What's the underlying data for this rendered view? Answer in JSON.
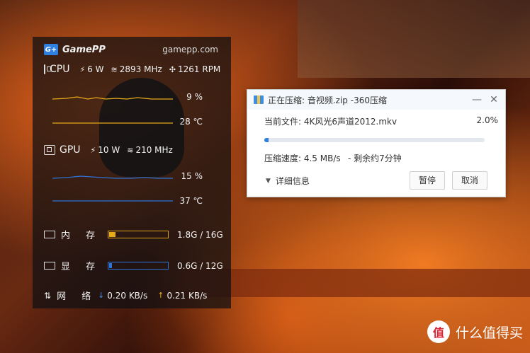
{
  "gamepp": {
    "logo": "G+",
    "brand": "GamePP",
    "site": "gamepp.com",
    "cpu": {
      "label": "CPU",
      "power": "6 W",
      "clock": "2893 MHz",
      "fan": "1261 RPM",
      "usage": "9 %",
      "temp": "28 ℃"
    },
    "gpu": {
      "label": "GPU",
      "power": "10 W",
      "clock": "210 MHz",
      "usage": "15 %",
      "temp": "37 ℃"
    },
    "memory": {
      "label": "内 存",
      "value": "1.8G / 16G",
      "fraction": 0.1125
    },
    "vram": {
      "label": "显 存",
      "value": "0.6G / 12G",
      "fraction": 0.05
    },
    "network": {
      "label": "网 络",
      "down": "0.20 KB/s",
      "up": "0.21 KB/s"
    },
    "colors": {
      "cpu_line": "#e6a918",
      "gpu_line": "#2d74d8"
    }
  },
  "dialog": {
    "title": "正在压缩: 音视频.zip -360压缩",
    "current_file": "当前文件: 4K风光6声道2012.mkv",
    "percent_label": "2.0%",
    "progress": 0.02,
    "speed": "压缩速度: 4.5 MB/s",
    "remaining": "- 剩余约7分钟",
    "details": "详细信息",
    "pause_button": "暂停",
    "cancel_button": "取消",
    "accent": "#2f7fe0"
  },
  "watermark": {
    "seal": "值",
    "text": "什么值得买"
  }
}
